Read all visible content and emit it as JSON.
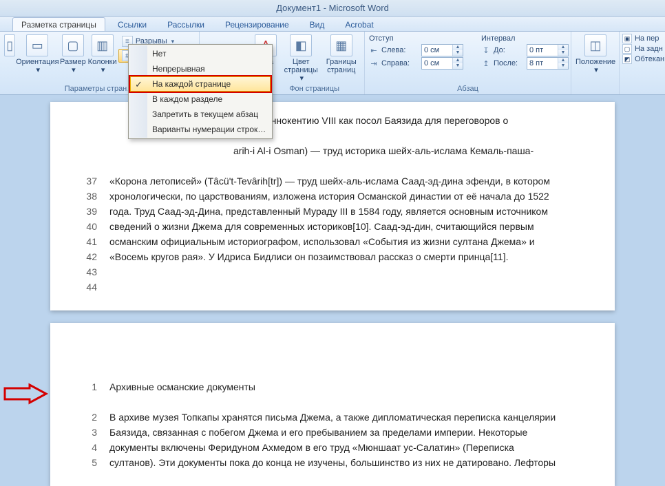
{
  "title": "Документ1 - Microsoft Word",
  "tabs": [
    "Разметка страницы",
    "Ссылки",
    "Рассылки",
    "Рецензирование",
    "Вид",
    "Acrobat"
  ],
  "ribbon": {
    "orientation": "Ориентация",
    "size": "Размер",
    "columns": "Колонки",
    "breaks": "Разрывы",
    "line_numbers": "Номера строк",
    "page_color": "Цвет страницы",
    "page_borders": "Границы страниц",
    "position": "Положение",
    "group_page_params": "Параметры стран…",
    "group_page_bg": "Фон страницы",
    "group_paragraph": "Абзац",
    "indent_title": "Отступ",
    "indent_left_lbl": "Слева:",
    "indent_left_val": "0 см",
    "indent_right_lbl": "Справа:",
    "indent_right_val": "0 см",
    "spacing_title": "Интервал",
    "spacing_before_lbl": "До:",
    "spacing_before_val": "0 пт",
    "spacing_after_lbl": "После:",
    "spacing_after_val": "8 пт",
    "right": [
      "На пер",
      "На задн",
      "Обтекан"
    ]
  },
  "menu": {
    "items": [
      "Нет",
      "Непрерывная",
      "На каждой странице",
      "В каждом разделе",
      "Запретить в текущем абзац",
      "Варианты нумерации строк…"
    ],
    "selected_index": 2
  },
  "page1": {
    "top_fragment": "к папе Иннокентию VIII как посол Баязида для переговоров о",
    "mid_fragment": "arih-i Al-i Osman) — труд историка шейх-аль-ислама Кемаль-паша-",
    "lines": [
      {
        "n": "37",
        "t": "«Корона летописей» (Tâcü't-Tevârih[tr]) — труд шейх-аль-ислама Саад-эд-дина эфенди, в котором"
      },
      {
        "n": "38",
        "t": "хронологически, по царствованиям, изложена история Османской династии от её начала до 1522"
      },
      {
        "n": "39",
        "t": "года. Труд Саад-эд-Дина, представленный Мураду III в 1584 году, является основным источником"
      },
      {
        "n": "40",
        "t": "сведений о жизни Джема для современных историков[10]. Саад-эд-дин, считающийся первым"
      },
      {
        "n": "41",
        "t": "османским официальным историографом, использовал «События из жизни султана Джема» и"
      },
      {
        "n": "42",
        "t": "«Восемь кругов рая». У Идриса Бидлиси он позаимствовал рассказ о смерти принца[11]."
      },
      {
        "n": "43",
        "t": ""
      },
      {
        "n": "44",
        "t": ""
      }
    ]
  },
  "page2": {
    "lines": [
      {
        "n": "1",
        "t": "Архивные османские документы"
      },
      {
        "n": "",
        "t": ""
      },
      {
        "n": "2",
        "t": "В архиве музея Топкапы хранятся письма Джема, а также дипломатическая переписка канцелярии"
      },
      {
        "n": "3",
        "t": "Баязида, связанная с побегом Джема и его пребыванием за пределами империи. Некоторые"
      },
      {
        "n": "4",
        "t": "документы включены Феридуном Ахмедом в его труд «Мюншаат ус-Салатин» (Переписка"
      },
      {
        "n": "5",
        "t": "султанов). Эти документы пока до конца не изучены, большинство из них не датировано. Лефторы"
      }
    ]
  }
}
